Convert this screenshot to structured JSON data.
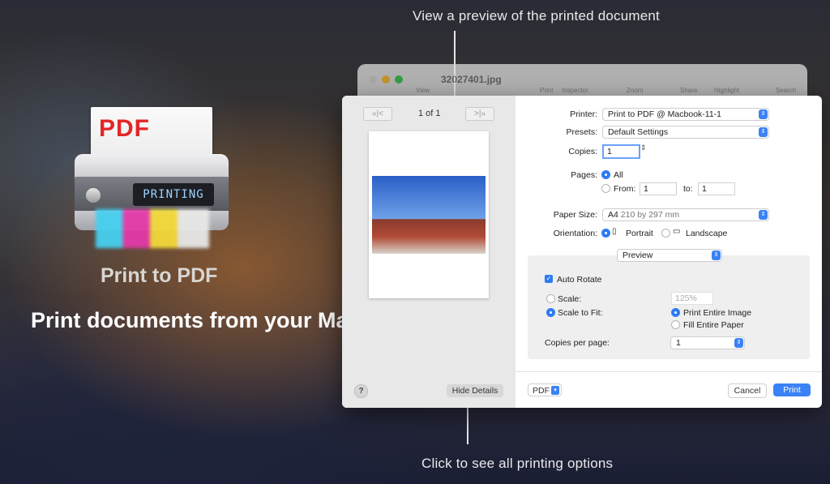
{
  "captions": {
    "top": "View a preview of the printed document",
    "bottom": "Click to see all printing options"
  },
  "promo": {
    "icon_paper_text": "PDF",
    "icon_display_text": "PRINTING",
    "app_name": "Print to PDF",
    "tagline": "Print documents from your Mac"
  },
  "background_window": {
    "filename": "32027401.jpg",
    "toolbar": [
      "View",
      "Print",
      "Inspector",
      "Zoom",
      "Share",
      "Highlight",
      "Search"
    ]
  },
  "dialog": {
    "preview": {
      "page_counter": "1 of 1",
      "first_prev": "«|<",
      "next_last": ">|»"
    },
    "help_label": "?",
    "hide_details_label": "Hide Details",
    "printer": {
      "label": "Printer:",
      "value": "Print to PDF @ Macbook-11-1"
    },
    "presets": {
      "label": "Presets:",
      "value": "Default Settings"
    },
    "copies": {
      "label": "Copies:",
      "value": "1"
    },
    "pages": {
      "label": "Pages:",
      "all_label": "All",
      "from_label": "From:",
      "from_value": "1",
      "to_label": "to:",
      "to_value": "1"
    },
    "paper_size": {
      "label": "Paper Size:",
      "value": "A4",
      "detail": "210 by 297 mm"
    },
    "orientation": {
      "label": "Orientation:",
      "portrait": "Portrait",
      "landscape": "Landscape"
    },
    "section_select": "Preview",
    "auto_rotate": "Auto Rotate",
    "scale": {
      "label": "Scale:",
      "value": "125%"
    },
    "scale_to_fit": "Scale to Fit:",
    "print_entire_image": "Print Entire Image",
    "fill_entire_paper": "Fill Entire Paper",
    "copies_per_page": {
      "label": "Copies per page:",
      "value": "1"
    },
    "pdf_label": "PDF",
    "cancel_label": "Cancel",
    "print_label": "Print"
  },
  "colors": {
    "accent": "#3b82f6",
    "icon_pdf_red": "#e32626"
  }
}
